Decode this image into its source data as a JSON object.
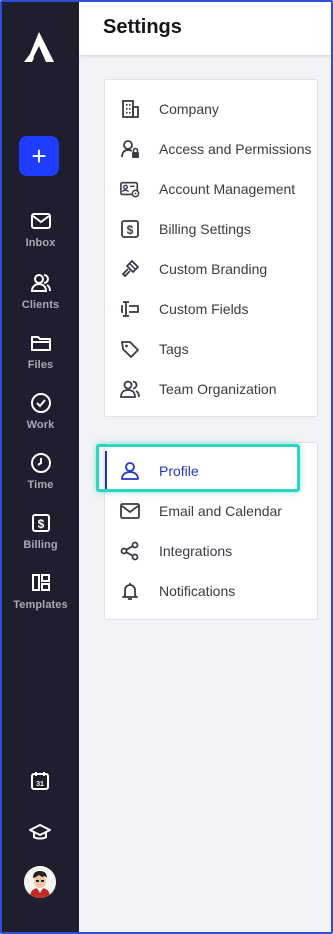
{
  "app": {
    "sidebar": {
      "items": [
        {
          "label": "Inbox",
          "icon": "mail-icon"
        },
        {
          "label": "Clients",
          "icon": "users-icon"
        },
        {
          "label": "Files",
          "icon": "folder-icon"
        },
        {
          "label": "Work",
          "icon": "check-circle-icon"
        },
        {
          "label": "Time",
          "icon": "clock-icon"
        },
        {
          "label": "Billing",
          "icon": "dollar-doc-icon"
        },
        {
          "label": "Templates",
          "icon": "templates-icon"
        }
      ],
      "calendar_day": "31"
    },
    "header": {
      "title": "Settings"
    },
    "firm_settings": [
      {
        "label": "Company",
        "icon": "building-icon"
      },
      {
        "label": "Access and Permissions",
        "icon": "user-lock-icon"
      },
      {
        "label": "Account Management",
        "icon": "id-card-gear-icon"
      },
      {
        "label": "Billing Settings",
        "icon": "dollar-doc-icon"
      },
      {
        "label": "Custom Branding",
        "icon": "brush-icon"
      },
      {
        "label": "Custom Fields",
        "icon": "field-icon"
      },
      {
        "label": "Tags",
        "icon": "tag-icon"
      },
      {
        "label": "Team Organization",
        "icon": "team-icon"
      }
    ],
    "personal_settings": [
      {
        "label": "Profile",
        "icon": "user-icon",
        "active": true
      },
      {
        "label": "Email and Calendar",
        "icon": "mail-icon"
      },
      {
        "label": "Integrations",
        "icon": "integrations-icon"
      },
      {
        "label": "Notifications",
        "icon": "bell-icon"
      }
    ],
    "colors": {
      "sidebar_bg": "#1f1e2e",
      "accent": "#1f3dff",
      "active_text": "#2436c9",
      "highlight": "#2dd4bf"
    }
  }
}
